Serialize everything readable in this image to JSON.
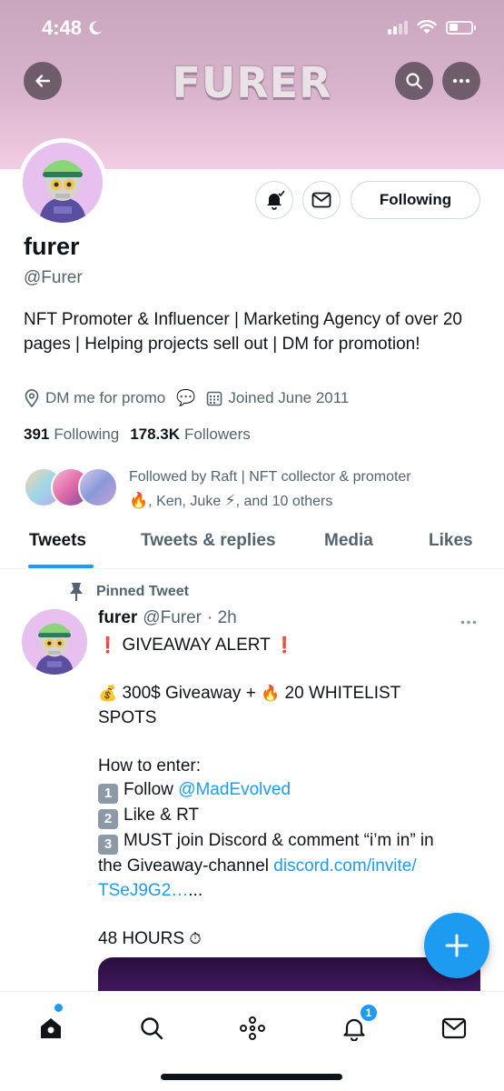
{
  "status_bar": {
    "time": "4:48"
  },
  "header": {
    "title": "FURER"
  },
  "profile": {
    "display_name": "furer",
    "handle": "@Furer",
    "bio": "NFT Promoter & Influencer | Marketing Agency of over 20 pages | Helping projects sell out | DM for promotion!",
    "location": "DM me for promo",
    "location_emoji": "💬",
    "joined": "Joined June 2011",
    "following_count": "391",
    "following_label": "Following",
    "followers_count": "178.3K",
    "followers_label": "Followers",
    "followed_by_line1": "Followed by Raft | NFT collector & promoter",
    "followed_by_line2_emoji": "🔥",
    "followed_by_line2_a": ", Ken, Juke",
    "followed_by_line2_emoji2": "⚡",
    "followed_by_line2_b": ", and 10 others",
    "following_button_label": "Following"
  },
  "tabs": [
    "Tweets",
    "Tweets & replies",
    "Media",
    "Likes"
  ],
  "tweet": {
    "pinned_label": "Pinned Tweet",
    "author_name": "furer",
    "author_handle": "@Furer",
    "time": "· 2h",
    "lines": {
      "l1_emoji": "❗",
      "l1_text": " GIVEAWAY ALERT ",
      "l1_emoji2": "❗",
      "l2_emoji": "💰",
      "l2_text_a": " 300$ Giveaway + ",
      "l2_emoji2": "🔥",
      "l2_text_b": " 20 WHITELIST",
      "l3_text": "SPOTS",
      "l4_text": "How to enter:",
      "l5_key": "1",
      "l5_text": "Follow ",
      "l5_link": "@MadEvolved",
      "l6_key": "2",
      "l6_text": "Like & RT",
      "l7_key": "3",
      "l7_text": "MUST join Discord & comment “i’m in” in",
      "l8_text": "the Giveaway-channel ",
      "l8_link": "discord.com/invite/",
      "l9_link": "TSeJ9G2…",
      "l9_text": "...",
      "l10_text": "48 HOURS ",
      "l10_emoji": "⏱"
    }
  },
  "bottom_nav": {
    "notifications_badge": "1"
  },
  "icons": [
    "back-arrow-icon",
    "search-icon",
    "more-icon",
    "bell-icon",
    "mail-icon",
    "location-icon",
    "calendar-icon",
    "pin-icon",
    "plus-icon",
    "home-icon",
    "spaces-icon"
  ],
  "colors": {
    "accent": "#1d9bf0",
    "banner": "#d9b4cd",
    "text_primary": "#0f1419",
    "text_secondary": "#536471"
  }
}
